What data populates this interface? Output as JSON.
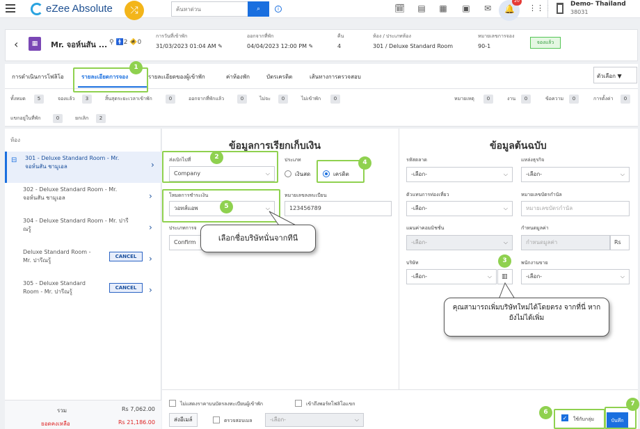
{
  "topbar": {
    "brand": "eZee Absolute",
    "search_placeholder": "ค้นหาด่วน",
    "notifications_count": "20",
    "property_name": "Demo- Thailand",
    "property_id": "38031"
  },
  "header": {
    "guest_name": "Mr. จอห์นสัน ...",
    "adults": "2",
    "children": "0",
    "arrival_label": "การวันที่เข้าพัก",
    "arrival_value": "31/03/2023 01:04 AM",
    "departure_label": "ออกจากที่พัก",
    "departure_value": "04/04/2023 12:00 PM",
    "nights_label": "คืน",
    "nights_value": "4",
    "room_label": "ห้อง / ประเภทห้อง",
    "room_value": "301 / Deluxe Standard Room",
    "res_no_label": "หมายเลขการจอง",
    "res_no_value": "90-1",
    "status": "จองแล้ว"
  },
  "tabs": [
    {
      "label": "การดำเนินการโฟลิโอ"
    },
    {
      "label": "รายละเอียดการจอง"
    },
    {
      "label": "รายละเอียดของผู้เข้าพัก"
    },
    {
      "label": "ค่าห้องพัก"
    },
    {
      "label": "บัตรเครดิต"
    },
    {
      "label": "เส้นทางการตรวจสอบ"
    }
  ],
  "options_label": "ตัวเลือก",
  "counts": [
    {
      "label": "ทั้งหมด",
      "value": "5"
    },
    {
      "label": "จองแล้ว",
      "value": "3"
    },
    {
      "label": "สิ้นสุดระยะเวลาเข้าพัก",
      "value": "0"
    },
    {
      "label": "ออกจากที่พักแล้ว",
      "value": "0"
    },
    {
      "label": "ไม่จะ",
      "value": "0"
    },
    {
      "label": "ไม่เข้าพัก",
      "value": "0"
    },
    {
      "label": "หมายเหตุ",
      "value": "0"
    },
    {
      "label": "งาน",
      "value": "0"
    },
    {
      "label": "ข้อความ",
      "value": "0"
    },
    {
      "label": "การตั้งค่า",
      "value": "0"
    },
    {
      "label": "แขกอยู่ในที่พัก",
      "value": "0"
    },
    {
      "label": "ยกเลิก",
      "value": "2"
    }
  ],
  "rooms_header": "ห้อง",
  "rooms": [
    {
      "line1": "301 - Deluxe Standard Room - Mr.",
      "line2": "จอห์นสัน ชามูเอล"
    },
    {
      "line1": "302 - Deluxe Standard Room - Mr.",
      "line2": "จอห์นสัน ชามูเอล"
    },
    {
      "line1": "304 - Deluxe Standard Room - Mr. ปารี",
      "line2": "ณรู้"
    },
    {
      "line1": "Deluxe Standard Room -",
      "line2": "Mr. ปารีณรู้"
    },
    {
      "line1": "305 - Deluxe Standard",
      "line2": "Room - Mr. ปารีณรู้"
    }
  ],
  "cancel_label": "CANCEL",
  "totals": {
    "total_label": "รวม",
    "total_value": "Rs 7,062.00",
    "balance_label": "ยอดคงเหลือ",
    "balance_value": "Rs 21,186.00"
  },
  "billing": {
    "title": "ข้อมูลการเรียกเก็บเงิน",
    "bill_to_label": "ส่งเบิกไปที่",
    "bill_to_value": "Company",
    "type_label": "ประเภท",
    "type_cash": "เงินสด",
    "type_credit": "เครดิต",
    "payment_mode_label": "โหมดการชำระเงิน",
    "payment_mode_value": "วอทส์แอพ",
    "reg_no_label": "หมายเลขลงทะเบียน",
    "reg_no_value": "123456789",
    "res_type_label": "ประเภทการจ",
    "res_type_value": "Confirm"
  },
  "source": {
    "title": "ข้อมูลต้นฉบับ",
    "market_code_label": "รหัสตลาด",
    "market_code_value": "-เลือก-",
    "business_source_label": "แหล่งธุรกิจ",
    "business_source_value": "-เลือก-",
    "travel_agent_label": "ตัวแทนการท่องเที่ยว",
    "travel_agent_value": "-เลือก-",
    "voucher_label": "หมายเลขบัตรกำนัล",
    "voucher_placeholder": "หมายเลขบัตรกำนัล",
    "commission_plan_label": "แผนค่าคอมมิชชั่น",
    "commission_plan_value": "-เลือก-",
    "value_label": "กำหนดมูลค่า",
    "value_placeholder": "กำหนดมูลค่า",
    "currency": "Rs",
    "company_label": "บริษัท",
    "company_value": "-เลือก-",
    "salesperson_label": "พนักงานขาย",
    "salesperson_value": "-เลือก-"
  },
  "bottom": {
    "hide_rate_label": "ไม่แสดงราคาบนบัตรลงทะเบียนผู้เข้าพัก",
    "portfolio_label": "เข้าถึงพอร์ทโฟลิโอแขก",
    "print_label": "ส่งอีเมล์",
    "check_email_label": "ตรวจสอบเมล",
    "email_select": "-เลือก-",
    "apply_group_label": "ใช้กับกลุ่ม",
    "save_label": "บันทึก"
  },
  "callouts": {
    "select_company": "เลือกชื่อบริษัทนั่นจากทีนี",
    "add_company": "คุณสามารถเพิ่มบริษัทใหม่ได้โดยตรง จากที่นี่ หากยังไม่ได้เพิ่ม"
  },
  "steps": [
    "1",
    "2",
    "3",
    "4",
    "5",
    "6",
    "7"
  ]
}
